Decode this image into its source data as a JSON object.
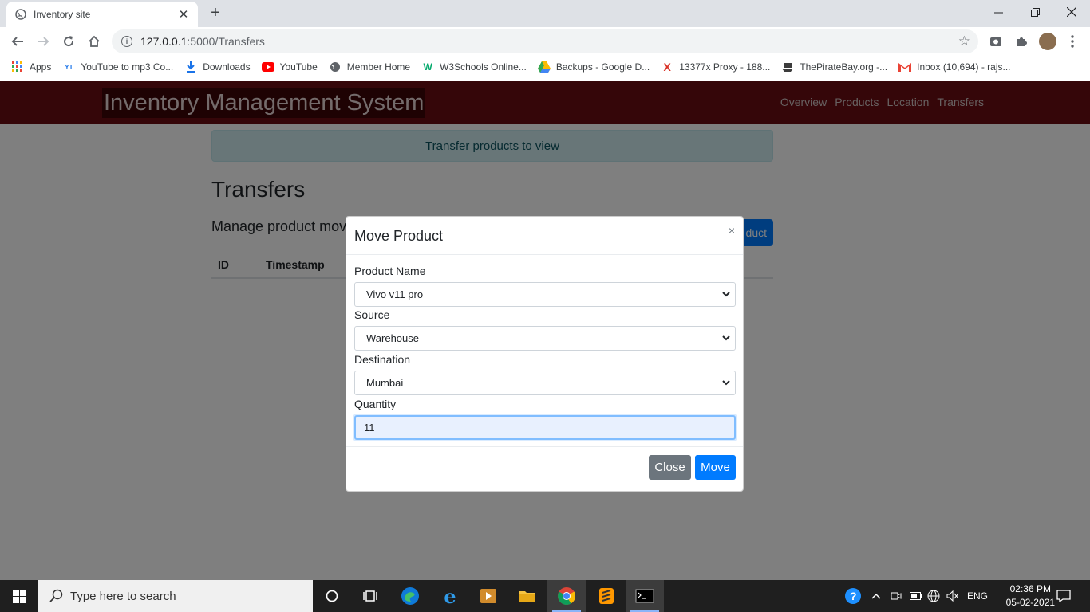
{
  "browser": {
    "tab_title": "Inventory site",
    "url_host": "127.0.0.1",
    "url_path": ":5000/Transfers",
    "bookmarks": [
      {
        "label": "Apps",
        "icon": "apps-grid-icon"
      },
      {
        "label": "YouTube to mp3 Co...",
        "icon": "ytmp3-icon"
      },
      {
        "label": "Downloads",
        "icon": "download-icon"
      },
      {
        "label": "YouTube",
        "icon": "youtube-icon"
      },
      {
        "label": "Member Home",
        "icon": "globe-icon"
      },
      {
        "label": "W3Schools Online...",
        "icon": "w3schools-icon"
      },
      {
        "label": "Backups - Google D...",
        "icon": "google-drive-icon"
      },
      {
        "label": "13377x Proxy - 188...",
        "icon": "x-icon"
      },
      {
        "label": "ThePirateBay.org -...",
        "icon": "pirate-ship-icon"
      },
      {
        "label": "Inbox (10,694) - rajs...",
        "icon": "gmail-icon"
      }
    ]
  },
  "app": {
    "brand": "Inventory Management System",
    "nav": [
      "Overview",
      "Products",
      "Location",
      "Transfers"
    ],
    "alert": "Transfer products to view",
    "heading": "Transfers",
    "lead": "Manage product move",
    "add_button": "duct",
    "table_headers": [
      "ID",
      "Timestamp"
    ]
  },
  "modal": {
    "title": "Move Product",
    "close_x": "×",
    "fields": {
      "product_label": "Product Name",
      "product_value": "Vivo v11 pro",
      "source_label": "Source",
      "source_value": "Warehouse",
      "destination_label": "Destination",
      "destination_value": "Mumbai",
      "quantity_label": "Quantity",
      "quantity_value": "11"
    },
    "close_button": "Close",
    "move_button": "Move"
  },
  "taskbar": {
    "search_placeholder": "Type here to search",
    "language": "ENG",
    "time": "02:36 PM",
    "date": "05-02-2021"
  },
  "colors": {
    "navbar": "#6b0d13",
    "primary": "#007bff",
    "secondary": "#6c757d",
    "alert_bg": "#d1ecf1"
  }
}
